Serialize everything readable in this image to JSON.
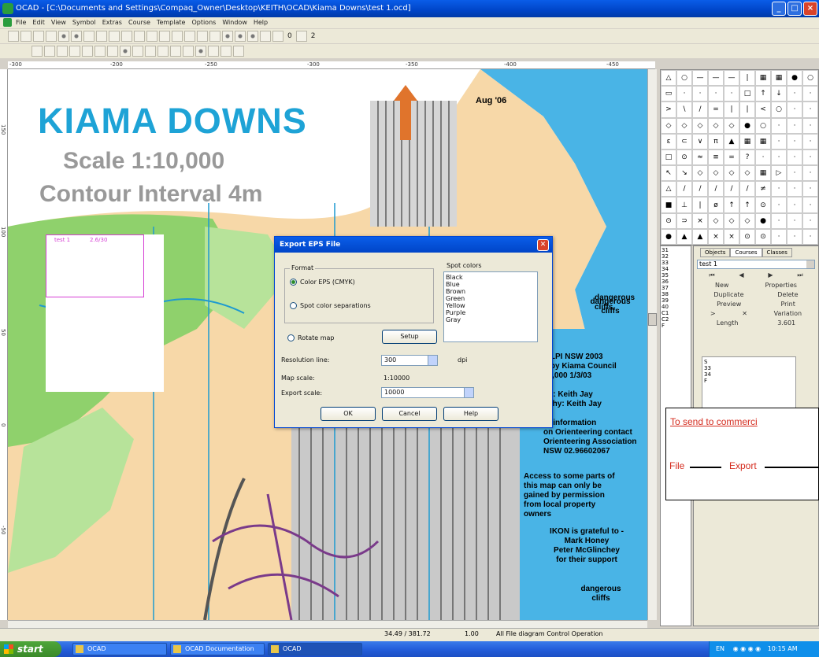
{
  "window": {
    "title": "OCAD - [C:\\Documents and Settings\\Compaq_Owner\\Desktop\\KEITH\\OCAD\\Kiama Downs\\test 1.ocd]"
  },
  "menu": [
    "File",
    "Edit",
    "View",
    "Symbol",
    "Extras",
    "Course",
    "Template",
    "Options",
    "Window",
    "Help"
  ],
  "toolbar": {
    "zoom_level": "0",
    "layer": "2"
  },
  "ruler": {
    "h_ticks": [
      "-300",
      "-200",
      "-250",
      "-300",
      "-350",
      "-400",
      "-450"
    ],
    "v_ticks": [
      "150",
      "100",
      "50",
      "0",
      "-50"
    ]
  },
  "map": {
    "title": "KIAMA DOWNS",
    "scale": "Scale 1:10,000",
    "contour": "Contour Interval 4m",
    "date": "Aug '06",
    "legend_header": [
      "test 1",
      "2.6/30"
    ],
    "cliff_labels": [
      "dangerous cliffs",
      "dangerous cliffs",
      "dangerous cliffs"
    ],
    "credits": "p LPI NSW 2003\nd by Kiama Council\n10,000 1/3/03\n\nrk :   Keith Jay\naphy: Keith Jay\n\nre information\non Orienteering contact\nOrienteering Association\nNSW 02.96602067",
    "access": "Access to some parts of\nthis map can only be\ngained by permission\nfrom local property\nowners",
    "thanks": "IKON is grateful to -\nMark Honey\nPeter McGlinchey\nfor their support"
  },
  "dialog": {
    "title": "Export EPS File",
    "format_legend": "Format",
    "format_option_1": "Color EPS (CMYK)",
    "format_option_2": "Spot color separations",
    "rotate_map": "Rotate map",
    "setup_label": "Setup",
    "separations_label": "Spot colors",
    "separations": [
      "Black",
      "Blue",
      "Brown",
      "Green",
      "Yellow",
      "Purple",
      "Gray"
    ],
    "resolution_label": "Resolution line:",
    "resolution_value": "300",
    "resolution_unit": "dpi",
    "map_scale_label": "Map scale:",
    "map_scale_value": "1:10000",
    "export_scale_label": "Export scale:",
    "export_scale_value": "10000",
    "ok": "OK",
    "cancel": "Cancel",
    "help": "Help"
  },
  "course_panel": {
    "tabs": [
      "Objects",
      "Courses",
      "Classes"
    ],
    "active_tab": "Courses",
    "selected_course": "test 1",
    "row1": [
      "New",
      "Properties"
    ],
    "row2": [
      "Duplicate",
      "Delete"
    ],
    "row3": [
      "Preview",
      "Print"
    ],
    "row4": [
      "Variation"
    ],
    "length_label": "Length",
    "length_value": "3.601",
    "list": [
      "S",
      "33",
      "34",
      "F"
    ]
  },
  "number_column": [
    "31",
    "32",
    "33",
    "34",
    "35",
    "36",
    "37",
    "38",
    "39",
    "40",
    "C1",
    "C2",
    "F"
  ],
  "annotation": {
    "link": "To send to commerci",
    "step1": "File",
    "step2": "Export"
  },
  "status": {
    "coords": "34.49 / 381.72",
    "zoom": "1.00",
    "hint": "All File diagram Control Operation"
  },
  "taskbar": {
    "start": "start",
    "tasks": [
      "OCAD",
      "OCAD Documentation",
      "OCAD"
    ],
    "tray_lang": "EN",
    "clock": "10:15 AM"
  },
  "colors": {
    "map_blue": "#1ea3d6",
    "map_gray": "#999999",
    "xp_blue": "#0045c8",
    "start_green": "#3a8a29",
    "annot_red": "#d42b1e"
  }
}
